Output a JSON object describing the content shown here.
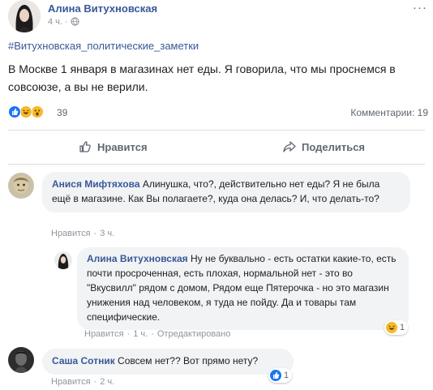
{
  "post": {
    "author": "Алина Витухновская",
    "time": "4 ч.",
    "more_icon": "more-dots-icon",
    "hashtag": "#Витухновская_политические_заметки",
    "text": "В Москве 1 января в магазинах нет еды. Я говорила, что мы проснемся в совсоюзе, а вы не верили.",
    "reactions": {
      "icons": [
        "like-icon",
        "haha-icon",
        "wow-icon"
      ],
      "count": "39"
    },
    "comments_count": "Комментарии: 19",
    "actions": {
      "like_label": "Нравится",
      "share_label": "Поделиться"
    }
  },
  "comments": [
    {
      "author": "Анися Мифтяхова",
      "text": "Алинушка, что?, действительно нет еды? Я не была ещё в магазине. Как Вы полагаете?, куда она делась? И, что делать-то?",
      "like_link": "Нравится",
      "time": "3 ч."
    },
    {
      "author": "Алина Витухновская",
      "text": "Ну не буквально - есть остатки какие-то, есть почти просроченная, есть плохая, нормальной нет - это во \"Вкусвилл\" рядом с домом, Рядом еще Пятерочка - но это магазин унижения над человеком, я туда не пойду. Да и товары там специфические.",
      "like_link": "Нравится",
      "time": "1 ч.",
      "edited": "Отредактировано",
      "reaction_icon": "haha-icon",
      "reaction_count": "1"
    },
    {
      "author": "Саша Сотник",
      "text": "Совсем нет?? Вот прямо нету?",
      "like_link": "Нравится",
      "time": "2 ч.",
      "reaction_icon": "like-icon",
      "reaction_count": "1"
    }
  ],
  "colors": {
    "link_blue": "#385898",
    "like_blue": "#1877f2",
    "haha_yellow": "#f7b928",
    "meta_gray": "#90949c",
    "bubble_bg": "#f2f3f5"
  }
}
